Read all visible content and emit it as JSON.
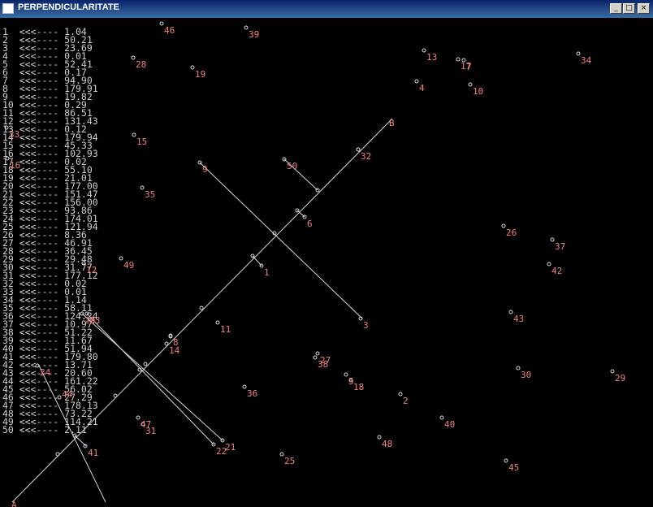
{
  "window": {
    "title": "PERPENDICULARITATE",
    "buttons": {
      "minimize": "_",
      "maximize": "□",
      "close": "×"
    }
  },
  "listing_separator": "<<<----",
  "listing": [
    {
      "n": "1",
      "v": "1.04"
    },
    {
      "n": "2",
      "v": "50.21"
    },
    {
      "n": "3",
      "v": "23.69"
    },
    {
      "n": "4",
      "v": "0.01"
    },
    {
      "n": "5",
      "v": "52.41"
    },
    {
      "n": "6",
      "v": "0.17"
    },
    {
      "n": "7",
      "v": "94.90"
    },
    {
      "n": "8",
      "v": "179.91"
    },
    {
      "n": "9",
      "v": "19.82"
    },
    {
      "n": "10",
      "v": "0.29"
    },
    {
      "n": "11",
      "v": "86.51"
    },
    {
      "n": "12",
      "v": "131.43"
    },
    {
      "n": "13",
      "v": "0.12"
    },
    {
      "n": "14",
      "v": "179.94"
    },
    {
      "n": "15",
      "v": "45.33"
    },
    {
      "n": "16",
      "v": "102.93"
    },
    {
      "n": "17",
      "v": "0.02"
    },
    {
      "n": "18",
      "v": "55.10"
    },
    {
      "n": "19",
      "v": "21.01"
    },
    {
      "n": "20",
      "v": "177.00"
    },
    {
      "n": "21",
      "v": "151.47"
    },
    {
      "n": "22",
      "v": "156.00"
    },
    {
      "n": "23",
      "v": "93.86"
    },
    {
      "n": "24",
      "v": "174.01"
    },
    {
      "n": "25",
      "v": "121.94"
    },
    {
      "n": "26",
      "v": "8.36"
    },
    {
      "n": "27",
      "v": "46.91"
    },
    {
      "n": "28",
      "v": "36.45"
    },
    {
      "n": "29",
      "v": "29.48"
    },
    {
      "n": "30",
      "v": "31.77"
    },
    {
      "n": "31",
      "v": "177.12"
    },
    {
      "n": "32",
      "v": "0.02"
    },
    {
      "n": "33",
      "v": "0.01"
    },
    {
      "n": "34",
      "v": "1.14"
    },
    {
      "n": "35",
      "v": "58.11"
    },
    {
      "n": "36",
      "v": "124.24"
    },
    {
      "n": "37",
      "v": "10.97"
    },
    {
      "n": "38",
      "v": "51.22"
    },
    {
      "n": "39",
      "v": "11.67"
    },
    {
      "n": "40",
      "v": "51.94"
    },
    {
      "n": "41",
      "v": "179.80"
    },
    {
      "n": "42",
      "v": "13.71"
    },
    {
      "n": "43",
      "v": "20.60"
    },
    {
      "n": "44",
      "v": "161.22"
    },
    {
      "n": "45",
      "v": "56.02"
    },
    {
      "n": "46",
      "v": "27.29"
    },
    {
      "n": "47",
      "v": "178.13"
    },
    {
      "n": "48",
      "v": "73.22"
    },
    {
      "n": "49",
      "v": "114.21"
    },
    {
      "n": "50",
      "v": "2.11"
    }
  ],
  "segment_labels": {
    "end_b": "B",
    "end_a": "A"
  },
  "points": [
    {
      "label": "46"
    },
    {
      "label": "39"
    },
    {
      "label": "13"
    },
    {
      "label": "17"
    },
    {
      "label": "34"
    },
    {
      "label": "28"
    },
    {
      "label": "19"
    },
    {
      "label": "4"
    },
    {
      "label": "10"
    },
    {
      "label": "33"
    },
    {
      "label": "15"
    },
    {
      "label": "16"
    },
    {
      "label": "32"
    },
    {
      "label": "9"
    },
    {
      "label": "50"
    },
    {
      "label": "35"
    },
    {
      "label": "6"
    },
    {
      "label": "26"
    },
    {
      "label": "37"
    },
    {
      "label": "1"
    },
    {
      "label": "49"
    },
    {
      "label": "12"
    },
    {
      "label": "42"
    },
    {
      "label": "3"
    },
    {
      "label": "20"
    },
    {
      "label": "23"
    },
    {
      "label": "43"
    },
    {
      "label": "11"
    },
    {
      "label": "8"
    },
    {
      "label": "14"
    },
    {
      "label": "27"
    },
    {
      "label": "38"
    },
    {
      "label": "24"
    },
    {
      "label": "5"
    },
    {
      "label": "18"
    },
    {
      "label": "30"
    },
    {
      "label": "29"
    },
    {
      "label": "36"
    },
    {
      "label": "2"
    },
    {
      "label": "47"
    },
    {
      "label": "31"
    },
    {
      "label": "40"
    },
    {
      "label": "21"
    },
    {
      "label": "22"
    },
    {
      "label": "48"
    },
    {
      "label": "41"
    },
    {
      "label": "25"
    },
    {
      "label": "45"
    },
    {
      "label": "44"
    },
    {
      "label": "7"
    }
  ]
}
